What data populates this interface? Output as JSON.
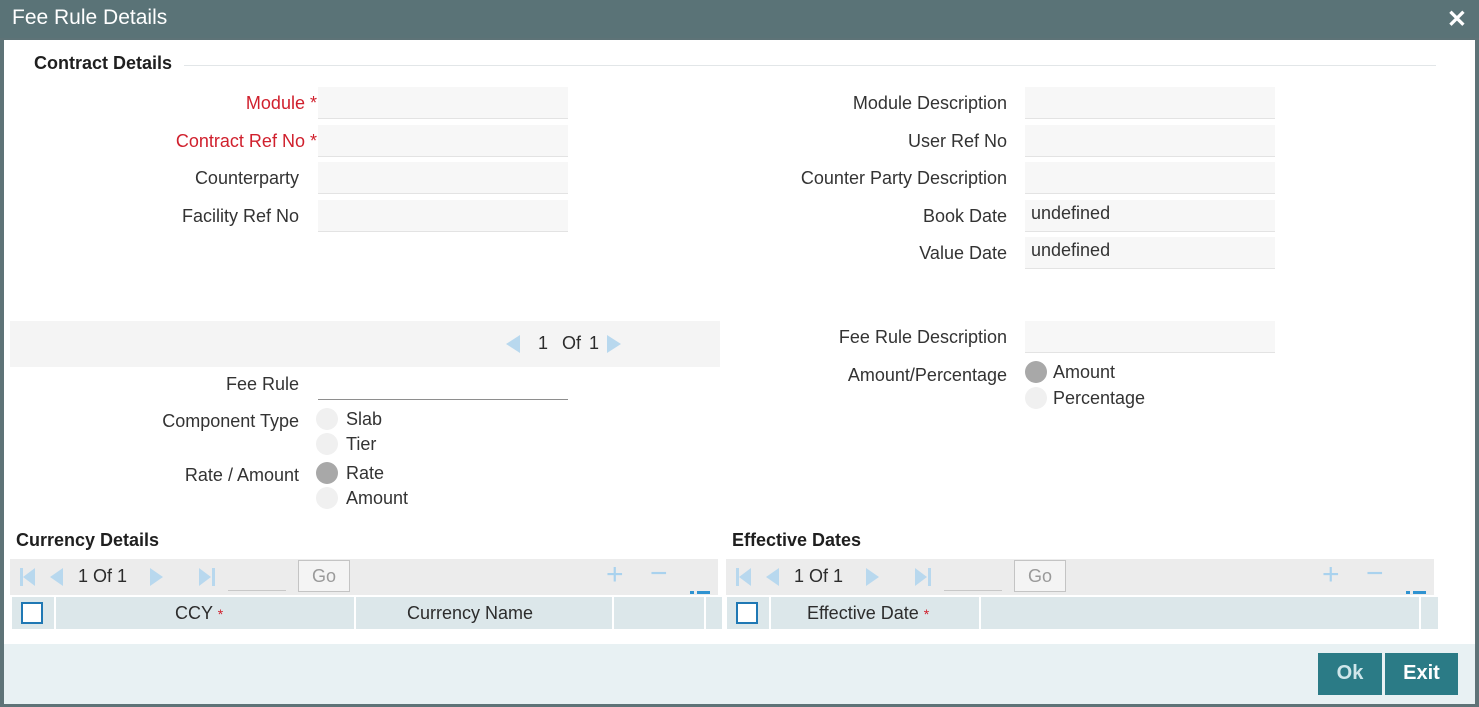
{
  "window": {
    "title": "Fee Rule Details"
  },
  "contract": {
    "section_title": "Contract Details",
    "module_label": "Module",
    "contract_ref_label": "Contract Ref No",
    "counterparty_label": "Counterparty",
    "facility_ref_label": "Facility Ref No",
    "module_desc_label": "Module Description",
    "user_ref_label": "User Ref No",
    "cp_desc_label": "Counter Party Description",
    "book_date_label": "Book Date",
    "book_date_value": "undefined",
    "value_date_label": "Value Date",
    "value_date_value": "undefined",
    "required_mark": "*"
  },
  "fee_rule": {
    "pager_current": "1",
    "pager_of": "Of",
    "pager_total": "1",
    "fee_rule_label": "Fee Rule",
    "component_type_label": "Component Type",
    "component_options": [
      "Slab",
      "Tier"
    ],
    "rate_amount_label": "Rate / Amount",
    "rate_amount_options": [
      "Rate",
      "Amount"
    ],
    "rate_amount_selected": "Rate",
    "fee_rule_desc_label": "Fee Rule Description",
    "amount_pct_label": "Amount/Percentage",
    "amount_pct_options": [
      "Amount",
      "Percentage"
    ],
    "amount_pct_selected": "Amount"
  },
  "currency_grid": {
    "title": "Currency Details",
    "pager": "1 Of 1",
    "go_label": "Go",
    "columns": [
      "CCY",
      "Currency Name"
    ],
    "required_mark": "*"
  },
  "effective_grid": {
    "title": "Effective Dates",
    "pager": "1 Of 1",
    "go_label": "Go",
    "columns": [
      "Effective Date"
    ],
    "required_mark": "*"
  },
  "footer": {
    "ok_label": "Ok",
    "exit_label": "Exit"
  },
  "icons": {
    "close": "close-icon",
    "prev": "triangle-left-icon",
    "next": "triangle-right-icon",
    "first": "first-page-icon",
    "last": "last-page-icon",
    "add": "plus-icon",
    "remove": "minus-icon",
    "columns": "list-icon"
  },
  "colors": {
    "titlebar": "#5a7377",
    "accent_button": "#2b7b86",
    "required": "#d0202d",
    "link_blue": "#1f78b4"
  }
}
